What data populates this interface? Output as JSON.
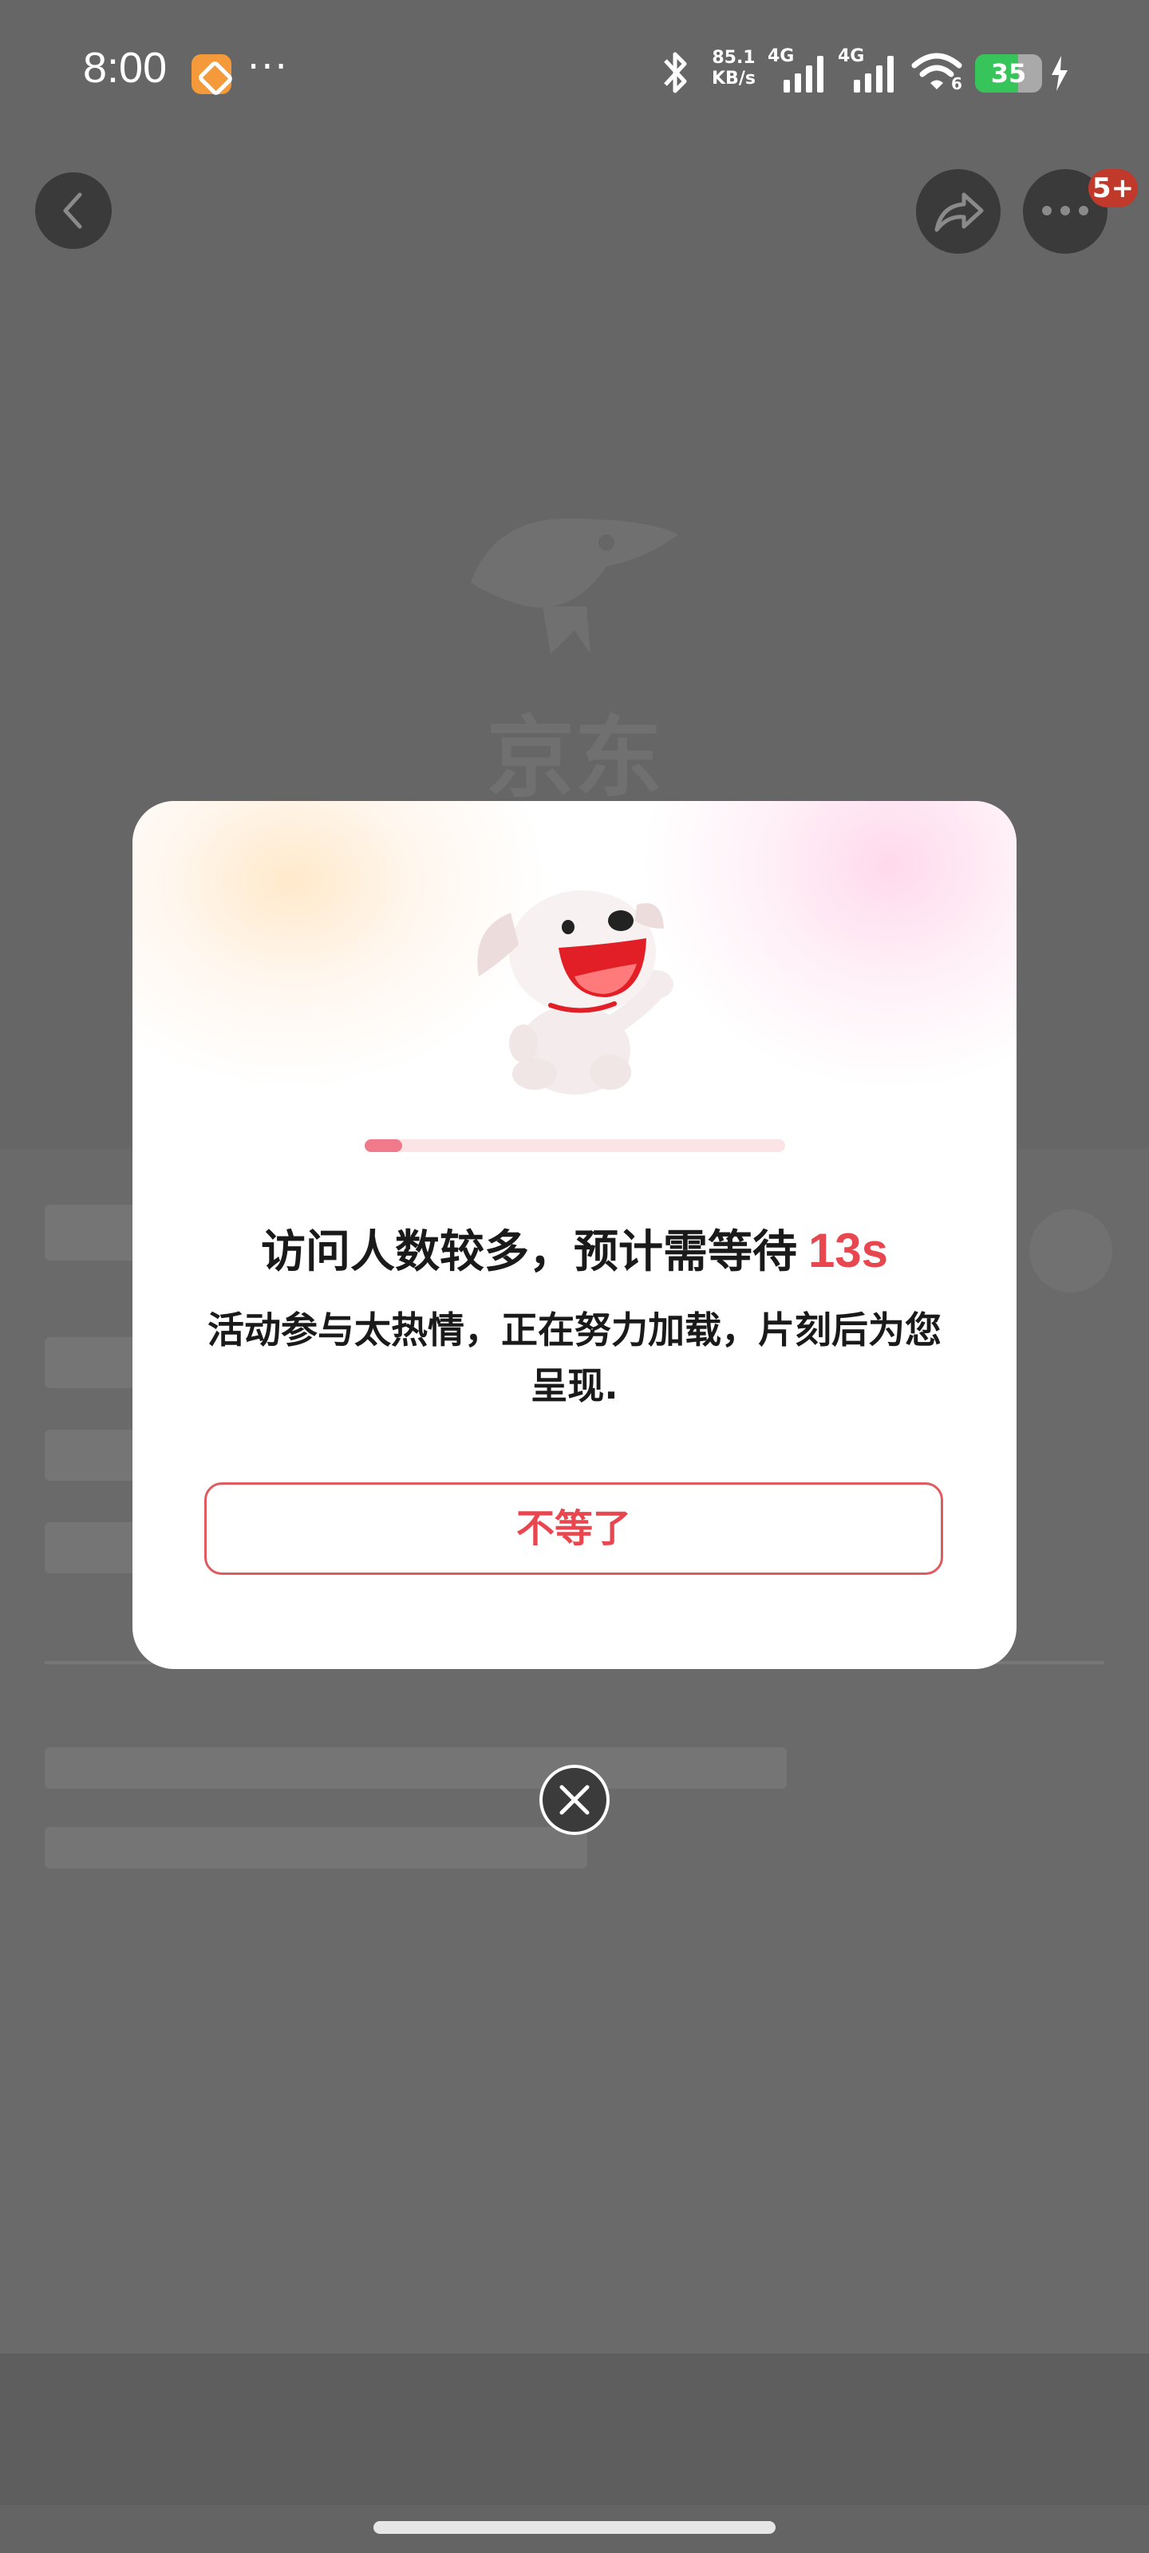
{
  "status_bar": {
    "time": "8:00",
    "more_dots": "···",
    "network_speed_value": "85.1",
    "network_speed_unit": "KB/s",
    "network_type_1": "4G",
    "network_type_2": "4G",
    "wifi_label": "6",
    "battery_level": "35",
    "icons": [
      "app-notification-icon",
      "bluetooth-icon",
      "signal-icon",
      "wifi-icon",
      "battery-icon",
      "charging-icon"
    ]
  },
  "top_nav": {
    "back_icon": "chevron-left-icon",
    "share_icon": "share-icon",
    "more_icon": "more-dots-icon",
    "notification_badge": "5+"
  },
  "watermark": {
    "logo_text": "京东"
  },
  "modal": {
    "title": "访问人数较多，预计需等待",
    "countdown": "13s",
    "description": "活动参与太热情，正在努力加载，片刻后为您呈现.",
    "button_label": "不等了",
    "progress_fraction": 0.09,
    "mascot": "jd-dog-mascot-illustration",
    "colors": {
      "accent": "#e9474f",
      "progress_track": "#fbe3e6",
      "progress_fill": "#f07a8a"
    }
  },
  "close_button": {
    "icon": "close-icon"
  }
}
